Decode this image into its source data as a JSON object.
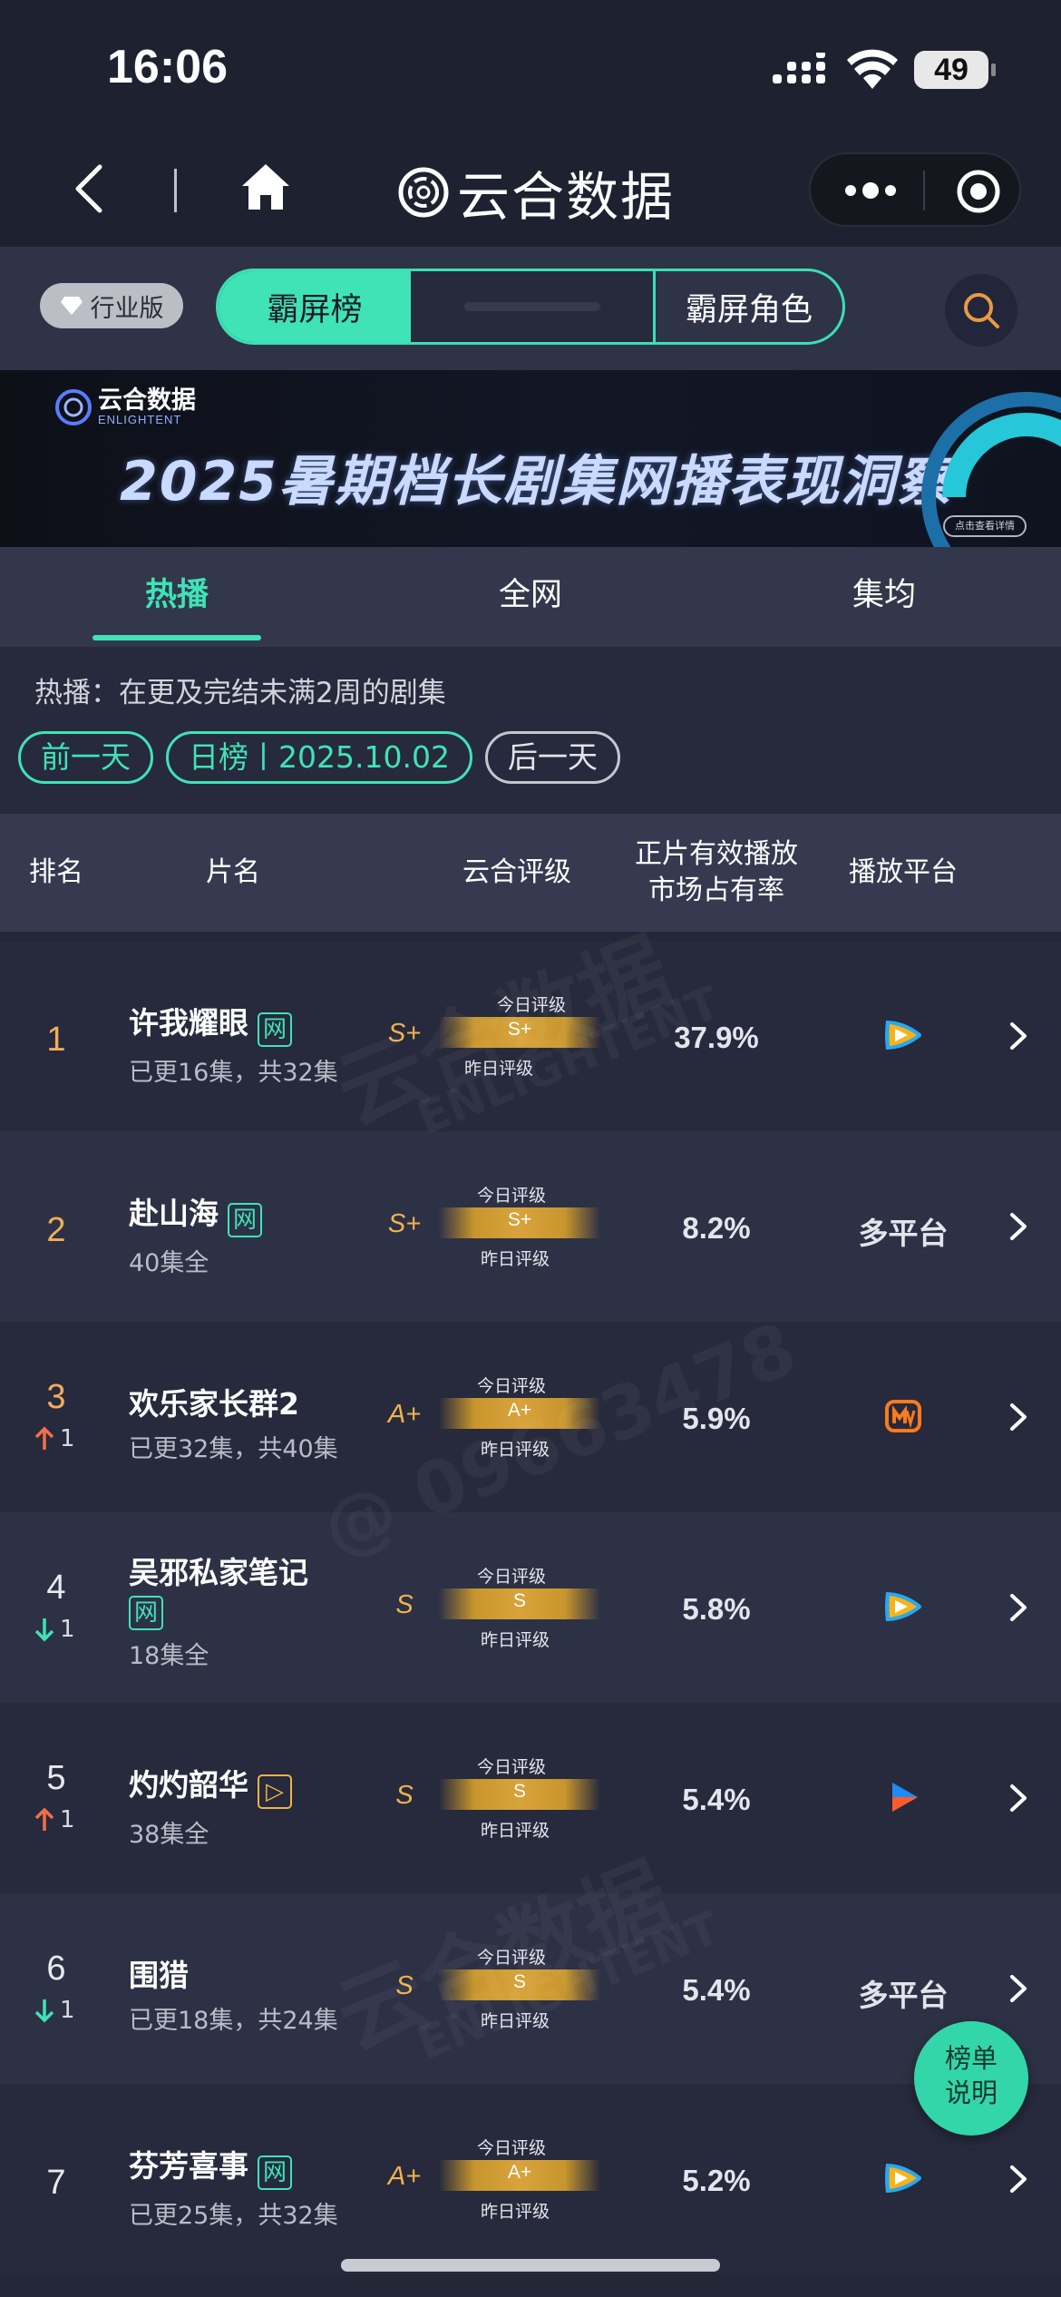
{
  "status": {
    "time": "16:06",
    "battery": "49"
  },
  "nav": {
    "title": "云合数据"
  },
  "toolbar": {
    "edition": "行业版",
    "segments": [
      "霸屏榜",
      "",
      "霸屏角色"
    ]
  },
  "banner": {
    "logo_name": "云合数据",
    "logo_sub": "ENLIGHTENT",
    "title": "2025暑期档长剧集网播表现洞察",
    "button": "点击查看详情"
  },
  "tabs": [
    "热播",
    "全网",
    "集均"
  ],
  "description": "热播：在更及完结未满2周的剧集",
  "date_nav": {
    "prev": "前一天",
    "current": "日榜丨2025.10.02",
    "next": "后一天"
  },
  "table_header": {
    "rank": "排名",
    "title": "片名",
    "grade": "云合评级",
    "share_line1": "正片有效播放",
    "share_line2": "市场占有率",
    "platform": "播放平台"
  },
  "gauge_labels": {
    "today": "今日评级",
    "yesterday": "昨日评级"
  },
  "rows": [
    {
      "rank": "1",
      "change": "",
      "title": "许我耀眼",
      "tag": "网",
      "subtitle": "已更16集，共32集",
      "grade": "S+",
      "bar_grade": "S+",
      "share": "37.9%",
      "platform": "tencent-video-icon",
      "platform_text": ""
    },
    {
      "rank": "2",
      "change": "",
      "title": "赴山海",
      "tag": "网",
      "subtitle": "40集全",
      "grade": "S+",
      "bar_grade": "S+",
      "share": "8.2%",
      "platform": "",
      "platform_text": "多平台"
    },
    {
      "rank": "3",
      "change": "1",
      "title": "欢乐家长群2",
      "tag": "",
      "subtitle": "已更32集，共40集",
      "grade": "A+",
      "bar_grade": "A+",
      "share": "5.9%",
      "platform": "mango-tv-icon",
      "platform_text": ""
    },
    {
      "rank": "4",
      "change": "1",
      "title": "吴邪私家笔记",
      "tag": "网",
      "subtitle": "18集全",
      "grade": "S",
      "bar_grade": "S",
      "share": "5.8%",
      "platform": "tencent-video-icon",
      "platform_text": ""
    },
    {
      "rank": "5",
      "change": "1",
      "title": "灼灼韶华",
      "tag": "▷",
      "subtitle": "38集全",
      "grade": "S",
      "bar_grade": "S",
      "share": "5.4%",
      "platform": "youku-icon",
      "platform_text": ""
    },
    {
      "rank": "6",
      "change": "1",
      "title": "围猎",
      "tag": "",
      "subtitle": "已更18集，共24集",
      "grade": "S",
      "bar_grade": "S",
      "share": "5.4%",
      "platform": "",
      "platform_text": "多平台"
    },
    {
      "rank": "7",
      "change": "",
      "title": "芬芳喜事",
      "tag": "网",
      "subtitle": "已更25集，共32集",
      "grade": "A+",
      "bar_grade": "A+",
      "share": "5.2%",
      "platform": "tencent-video-icon",
      "platform_text": ""
    }
  ],
  "fab": {
    "line1": "榜单",
    "line2": "说明"
  },
  "watermark": {
    "brand": "云合数据",
    "brand_en": "ENLIGHTENT",
    "id": "@ 09663478"
  },
  "colors": {
    "accent": "#3fe3b6",
    "gold": "#f2b24f",
    "up": "#f0704a",
    "down": "#3fe3b6"
  }
}
